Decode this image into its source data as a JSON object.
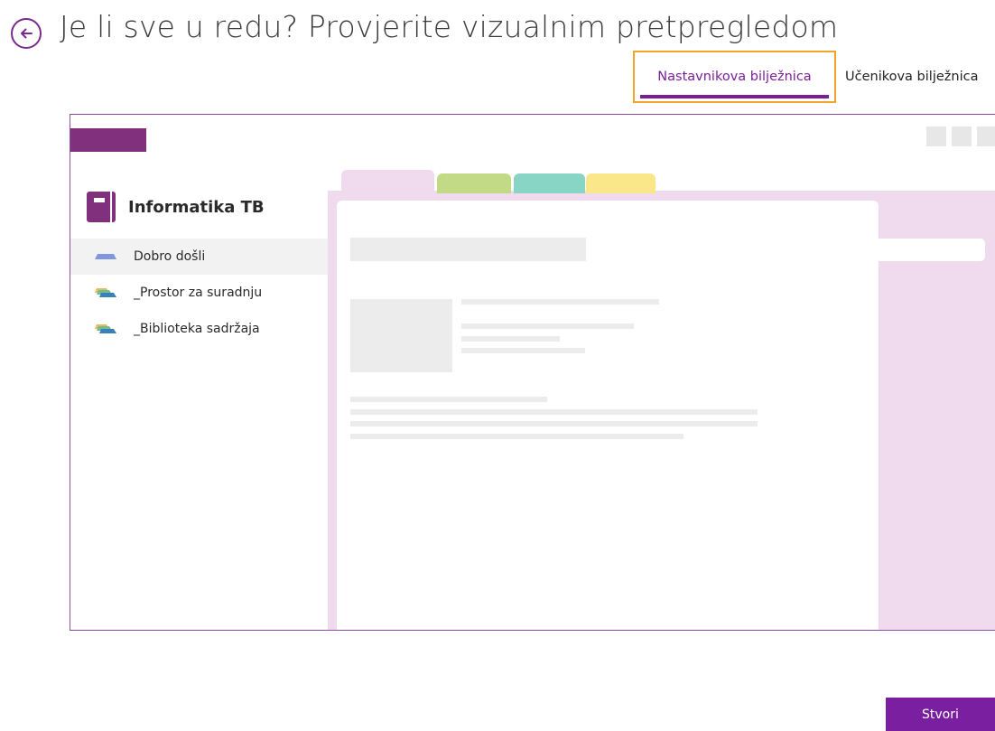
{
  "header": {
    "title": "Je li sve u redu? Provjerite vizualnim pretpregledom",
    "back_icon": "arrow-left-circle-icon"
  },
  "tabs": [
    {
      "label": "Nastavnikova bilježnica",
      "selected": true
    },
    {
      "label": "Učenikova bilježnica",
      "selected": false
    }
  ],
  "preview": {
    "notebook_title": "Informatika TB",
    "sections": [
      {
        "label": "Dobro došli",
        "icon": "section-group-blue-icon",
        "active": true
      },
      {
        "label": "_Prostor za suradnju",
        "icon": "section-group-multicolor-icon",
        "active": false
      },
      {
        "label": "_Biblioteka sadržaja",
        "icon": "section-group-multicolor-icon",
        "active": false
      }
    ],
    "colors": {
      "brand_purple": "#80307c",
      "pink": "#efdbed",
      "tab_green": "#c2d986",
      "tab_teal": "#88d4c5",
      "tab_yellow": "#fae78a"
    }
  },
  "footer": {
    "create_label": "Stvori"
  },
  "colors": {
    "accent": "#7a1f98",
    "tab_focus": "#f0a52a",
    "primary_button": "#7a1fa0"
  }
}
